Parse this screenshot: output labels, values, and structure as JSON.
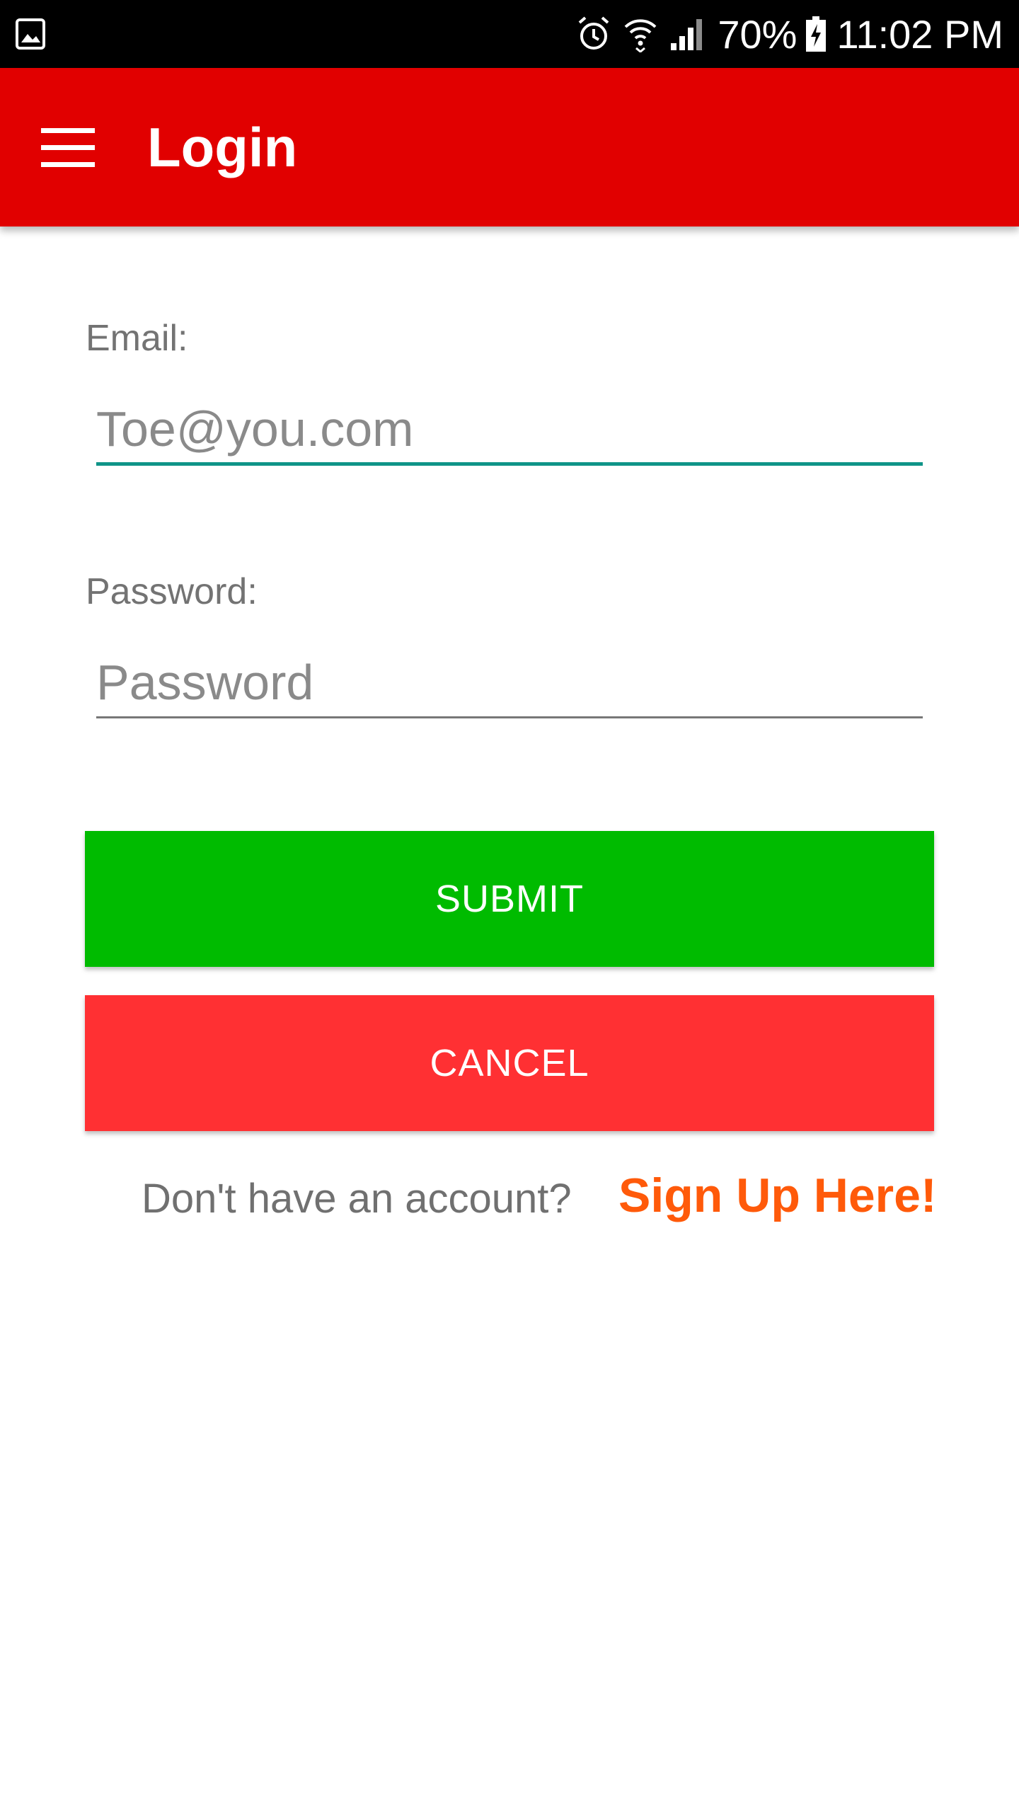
{
  "status_bar": {
    "battery_percent": "70%",
    "time": "11:02 PM",
    "icons": [
      "gallery-icon",
      "alarm-icon",
      "wifi-icon",
      "signal-icon",
      "battery-charging-icon"
    ]
  },
  "app_bar": {
    "title": "Login",
    "menu_icon": "hamburger-menu-icon",
    "color": "#e10000"
  },
  "form": {
    "email_label": "Email:",
    "email_value": "Toe@you.com",
    "password_label": "Password:",
    "password_placeholder": "Password",
    "submit_label": "SUBMIT",
    "cancel_label": "CANCEL",
    "submit_color": "#00bb00",
    "cancel_color": "#ff3033"
  },
  "signup": {
    "prompt": "Don't have an account?",
    "link_label": "Sign Up Here!",
    "link_color": "#ff5a0a"
  }
}
